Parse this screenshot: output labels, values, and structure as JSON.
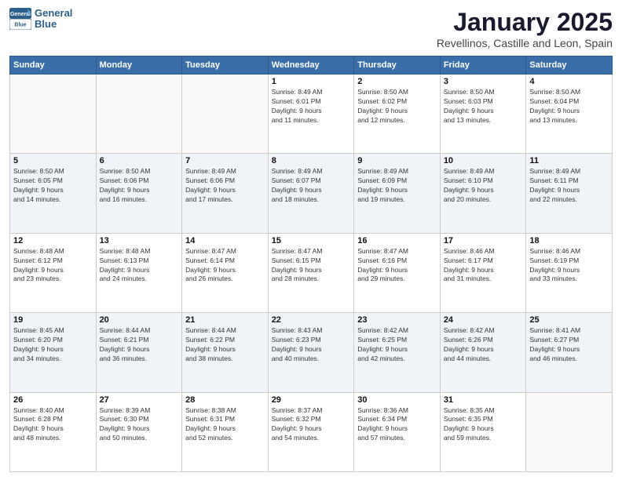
{
  "logo": {
    "text_general": "General",
    "text_blue": "Blue"
  },
  "header": {
    "month": "January 2025",
    "location": "Revellinos, Castille and Leon, Spain"
  },
  "weekdays": [
    "Sunday",
    "Monday",
    "Tuesday",
    "Wednesday",
    "Thursday",
    "Friday",
    "Saturday"
  ],
  "weeks": [
    [
      {
        "day": "",
        "info": ""
      },
      {
        "day": "",
        "info": ""
      },
      {
        "day": "",
        "info": ""
      },
      {
        "day": "1",
        "info": "Sunrise: 8:49 AM\nSunset: 6:01 PM\nDaylight: 9 hours\nand 11 minutes."
      },
      {
        "day": "2",
        "info": "Sunrise: 8:50 AM\nSunset: 6:02 PM\nDaylight: 9 hours\nand 12 minutes."
      },
      {
        "day": "3",
        "info": "Sunrise: 8:50 AM\nSunset: 6:03 PM\nDaylight: 9 hours\nand 13 minutes."
      },
      {
        "day": "4",
        "info": "Sunrise: 8:50 AM\nSunset: 6:04 PM\nDaylight: 9 hours\nand 13 minutes."
      }
    ],
    [
      {
        "day": "5",
        "info": "Sunrise: 8:50 AM\nSunset: 6:05 PM\nDaylight: 9 hours\nand 14 minutes."
      },
      {
        "day": "6",
        "info": "Sunrise: 8:50 AM\nSunset: 6:06 PM\nDaylight: 9 hours\nand 16 minutes."
      },
      {
        "day": "7",
        "info": "Sunrise: 8:49 AM\nSunset: 6:06 PM\nDaylight: 9 hours\nand 17 minutes."
      },
      {
        "day": "8",
        "info": "Sunrise: 8:49 AM\nSunset: 6:07 PM\nDaylight: 9 hours\nand 18 minutes."
      },
      {
        "day": "9",
        "info": "Sunrise: 8:49 AM\nSunset: 6:09 PM\nDaylight: 9 hours\nand 19 minutes."
      },
      {
        "day": "10",
        "info": "Sunrise: 8:49 AM\nSunset: 6:10 PM\nDaylight: 9 hours\nand 20 minutes."
      },
      {
        "day": "11",
        "info": "Sunrise: 8:49 AM\nSunset: 6:11 PM\nDaylight: 9 hours\nand 22 minutes."
      }
    ],
    [
      {
        "day": "12",
        "info": "Sunrise: 8:48 AM\nSunset: 6:12 PM\nDaylight: 9 hours\nand 23 minutes."
      },
      {
        "day": "13",
        "info": "Sunrise: 8:48 AM\nSunset: 6:13 PM\nDaylight: 9 hours\nand 24 minutes."
      },
      {
        "day": "14",
        "info": "Sunrise: 8:47 AM\nSunset: 6:14 PM\nDaylight: 9 hours\nand 26 minutes."
      },
      {
        "day": "15",
        "info": "Sunrise: 8:47 AM\nSunset: 6:15 PM\nDaylight: 9 hours\nand 28 minutes."
      },
      {
        "day": "16",
        "info": "Sunrise: 8:47 AM\nSunset: 6:16 PM\nDaylight: 9 hours\nand 29 minutes."
      },
      {
        "day": "17",
        "info": "Sunrise: 8:46 AM\nSunset: 6:17 PM\nDaylight: 9 hours\nand 31 minutes."
      },
      {
        "day": "18",
        "info": "Sunrise: 8:46 AM\nSunset: 6:19 PM\nDaylight: 9 hours\nand 33 minutes."
      }
    ],
    [
      {
        "day": "19",
        "info": "Sunrise: 8:45 AM\nSunset: 6:20 PM\nDaylight: 9 hours\nand 34 minutes."
      },
      {
        "day": "20",
        "info": "Sunrise: 8:44 AM\nSunset: 6:21 PM\nDaylight: 9 hours\nand 36 minutes."
      },
      {
        "day": "21",
        "info": "Sunrise: 8:44 AM\nSunset: 6:22 PM\nDaylight: 9 hours\nand 38 minutes."
      },
      {
        "day": "22",
        "info": "Sunrise: 8:43 AM\nSunset: 6:23 PM\nDaylight: 9 hours\nand 40 minutes."
      },
      {
        "day": "23",
        "info": "Sunrise: 8:42 AM\nSunset: 6:25 PM\nDaylight: 9 hours\nand 42 minutes."
      },
      {
        "day": "24",
        "info": "Sunrise: 8:42 AM\nSunset: 6:26 PM\nDaylight: 9 hours\nand 44 minutes."
      },
      {
        "day": "25",
        "info": "Sunrise: 8:41 AM\nSunset: 6:27 PM\nDaylight: 9 hours\nand 46 minutes."
      }
    ],
    [
      {
        "day": "26",
        "info": "Sunrise: 8:40 AM\nSunset: 6:28 PM\nDaylight: 9 hours\nand 48 minutes."
      },
      {
        "day": "27",
        "info": "Sunrise: 8:39 AM\nSunset: 6:30 PM\nDaylight: 9 hours\nand 50 minutes."
      },
      {
        "day": "28",
        "info": "Sunrise: 8:38 AM\nSunset: 6:31 PM\nDaylight: 9 hours\nand 52 minutes."
      },
      {
        "day": "29",
        "info": "Sunrise: 8:37 AM\nSunset: 6:32 PM\nDaylight: 9 hours\nand 54 minutes."
      },
      {
        "day": "30",
        "info": "Sunrise: 8:36 AM\nSunset: 6:34 PM\nDaylight: 9 hours\nand 57 minutes."
      },
      {
        "day": "31",
        "info": "Sunrise: 8:35 AM\nSunset: 6:35 PM\nDaylight: 9 hours\nand 59 minutes."
      },
      {
        "day": "",
        "info": ""
      }
    ]
  ]
}
